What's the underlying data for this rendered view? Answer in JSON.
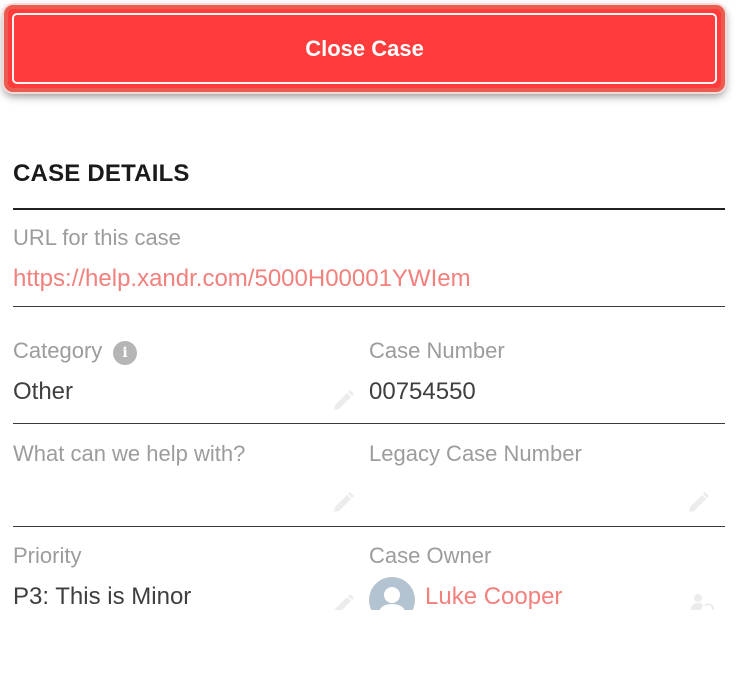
{
  "close_case_button": {
    "label": "Close Case"
  },
  "case_details": {
    "title": "CASE DETAILS",
    "url": {
      "label": "URL for this case",
      "value": "https://help.xandr.com/5000H00001YWIem"
    },
    "category": {
      "label": "Category",
      "value": "Other"
    },
    "case_number": {
      "label": "Case Number",
      "value": "00754550"
    },
    "help_with": {
      "label": "What can we help with?",
      "value": ""
    },
    "legacy_case_number": {
      "label": "Legacy Case Number",
      "value": ""
    },
    "priority": {
      "label": "Priority",
      "value": "P3: This is Minor"
    },
    "case_owner": {
      "label": "Case Owner",
      "value": "Luke Cooper"
    }
  },
  "icons": {
    "info": "info-icon",
    "edit": "pencil-icon",
    "change_owner": "change-owner-icon",
    "avatar": "user-avatar-icon"
  },
  "colors": {
    "button_bg": "#ff3b3b",
    "link": "#f2807c",
    "label": "#9c9c9c",
    "value": "#3f3f3f"
  }
}
